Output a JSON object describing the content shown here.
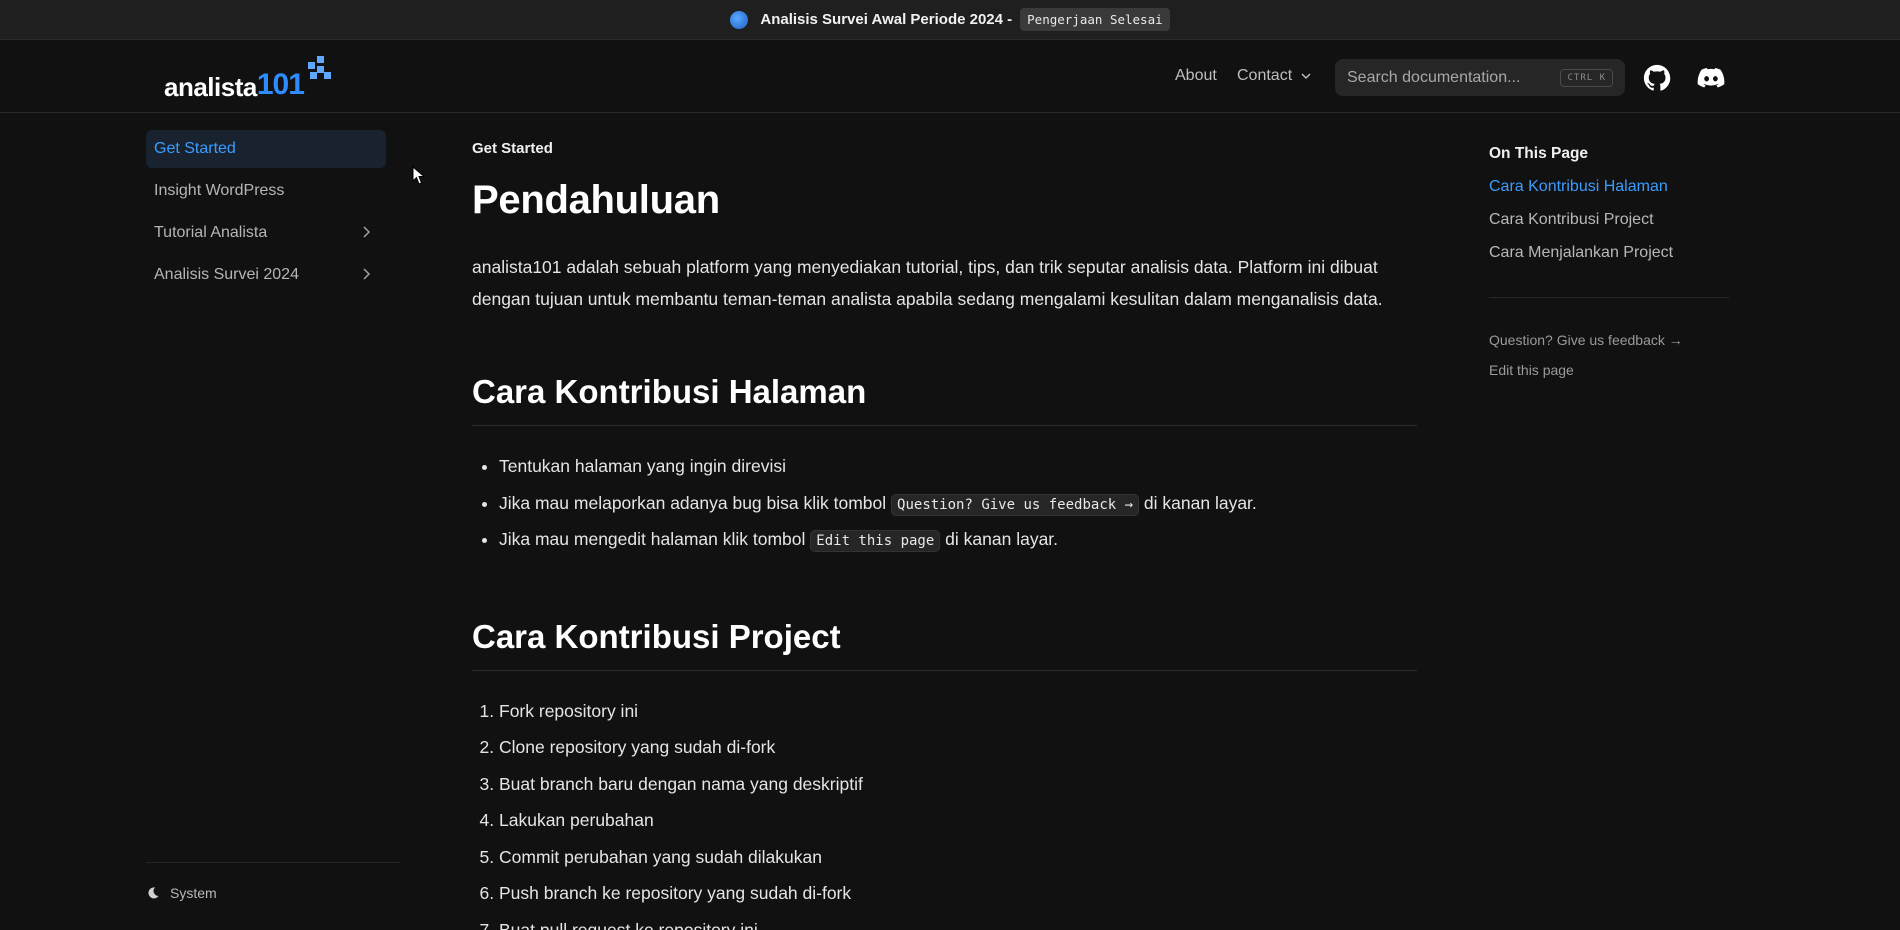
{
  "banner": {
    "title": "Analisis Survei Awal Periode 2024 -",
    "badge": "Pengerjaan Selesai"
  },
  "header": {
    "logo_word": "analista",
    "logo_num": "101",
    "nav": {
      "about": "About",
      "contact": "Contact"
    },
    "search": {
      "placeholder": "Search documentation...",
      "shortcut": "CTRL K"
    },
    "icons": [
      "github-icon",
      "discord-icon"
    ]
  },
  "sidebar": {
    "items": [
      {
        "label": "Get Started",
        "active": true
      },
      {
        "label": "Insight WordPress"
      },
      {
        "label": "Tutorial Analista",
        "expandable": true
      },
      {
        "label": "Analisis Survei 2024",
        "expandable": true
      }
    ],
    "theme_label": "System"
  },
  "main": {
    "breadcrumb": "Get Started",
    "title": "Pendahuluan",
    "intro": "analista101 adalah sebuah platform yang menyediakan tutorial, tips, dan trik seputar analisis data. Platform ini dibuat dengan tujuan untuk membantu teman-teman analista apabila sedang mengalami kesulitan dalam menganalisis data.",
    "section1": {
      "heading": "Cara Kontribusi Halaman",
      "item1": "Tentukan halaman yang ingin direvisi",
      "item2_pre": "Jika mau melaporkan adanya bug bisa klik tombol",
      "item2_code": "Question? Give us feedback →",
      "item2_post": "di kanan layar.",
      "item3_pre": "Jika mau mengedit halaman klik tombol",
      "item3_code": "Edit this page",
      "item3_post": "di kanan layar."
    },
    "section2": {
      "heading": "Cara Kontribusi Project",
      "steps": [
        "Fork repository ini",
        "Clone repository yang sudah di-fork",
        "Buat branch baru dengan nama yang deskriptif",
        "Lakukan perubahan",
        "Commit perubahan yang sudah dilakukan",
        "Push branch ke repository yang sudah di-fork",
        "Buat pull request ke repository ini"
      ]
    }
  },
  "toc": {
    "title": "On This Page",
    "items": [
      "Cara Kontribusi Halaman",
      "Cara Kontribusi Project",
      "Cara Menjalankan Project"
    ],
    "feedback": "Question? Give us feedback →",
    "edit": "Edit this page"
  },
  "colors": {
    "accent": "#3b9cff",
    "background": "#111111"
  }
}
